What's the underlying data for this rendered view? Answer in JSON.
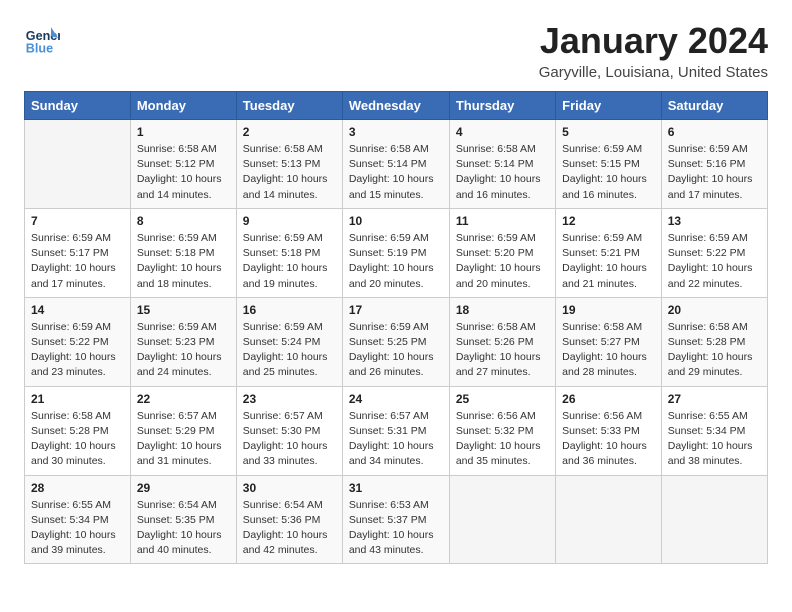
{
  "header": {
    "logo_line1": "General",
    "logo_line2": "Blue",
    "month_year": "January 2024",
    "location": "Garyville, Louisiana, United States"
  },
  "weekdays": [
    "Sunday",
    "Monday",
    "Tuesday",
    "Wednesday",
    "Thursday",
    "Friday",
    "Saturday"
  ],
  "weeks": [
    [
      {
        "day": "",
        "info": ""
      },
      {
        "day": "1",
        "info": "Sunrise: 6:58 AM\nSunset: 5:12 PM\nDaylight: 10 hours\nand 14 minutes."
      },
      {
        "day": "2",
        "info": "Sunrise: 6:58 AM\nSunset: 5:13 PM\nDaylight: 10 hours\nand 14 minutes."
      },
      {
        "day": "3",
        "info": "Sunrise: 6:58 AM\nSunset: 5:14 PM\nDaylight: 10 hours\nand 15 minutes."
      },
      {
        "day": "4",
        "info": "Sunrise: 6:58 AM\nSunset: 5:14 PM\nDaylight: 10 hours\nand 16 minutes."
      },
      {
        "day": "5",
        "info": "Sunrise: 6:59 AM\nSunset: 5:15 PM\nDaylight: 10 hours\nand 16 minutes."
      },
      {
        "day": "6",
        "info": "Sunrise: 6:59 AM\nSunset: 5:16 PM\nDaylight: 10 hours\nand 17 minutes."
      }
    ],
    [
      {
        "day": "7",
        "info": "Sunrise: 6:59 AM\nSunset: 5:17 PM\nDaylight: 10 hours\nand 17 minutes."
      },
      {
        "day": "8",
        "info": "Sunrise: 6:59 AM\nSunset: 5:18 PM\nDaylight: 10 hours\nand 18 minutes."
      },
      {
        "day": "9",
        "info": "Sunrise: 6:59 AM\nSunset: 5:18 PM\nDaylight: 10 hours\nand 19 minutes."
      },
      {
        "day": "10",
        "info": "Sunrise: 6:59 AM\nSunset: 5:19 PM\nDaylight: 10 hours\nand 20 minutes."
      },
      {
        "day": "11",
        "info": "Sunrise: 6:59 AM\nSunset: 5:20 PM\nDaylight: 10 hours\nand 20 minutes."
      },
      {
        "day": "12",
        "info": "Sunrise: 6:59 AM\nSunset: 5:21 PM\nDaylight: 10 hours\nand 21 minutes."
      },
      {
        "day": "13",
        "info": "Sunrise: 6:59 AM\nSunset: 5:22 PM\nDaylight: 10 hours\nand 22 minutes."
      }
    ],
    [
      {
        "day": "14",
        "info": "Sunrise: 6:59 AM\nSunset: 5:22 PM\nDaylight: 10 hours\nand 23 minutes."
      },
      {
        "day": "15",
        "info": "Sunrise: 6:59 AM\nSunset: 5:23 PM\nDaylight: 10 hours\nand 24 minutes."
      },
      {
        "day": "16",
        "info": "Sunrise: 6:59 AM\nSunset: 5:24 PM\nDaylight: 10 hours\nand 25 minutes."
      },
      {
        "day": "17",
        "info": "Sunrise: 6:59 AM\nSunset: 5:25 PM\nDaylight: 10 hours\nand 26 minutes."
      },
      {
        "day": "18",
        "info": "Sunrise: 6:58 AM\nSunset: 5:26 PM\nDaylight: 10 hours\nand 27 minutes."
      },
      {
        "day": "19",
        "info": "Sunrise: 6:58 AM\nSunset: 5:27 PM\nDaylight: 10 hours\nand 28 minutes."
      },
      {
        "day": "20",
        "info": "Sunrise: 6:58 AM\nSunset: 5:28 PM\nDaylight: 10 hours\nand 29 minutes."
      }
    ],
    [
      {
        "day": "21",
        "info": "Sunrise: 6:58 AM\nSunset: 5:28 PM\nDaylight: 10 hours\nand 30 minutes."
      },
      {
        "day": "22",
        "info": "Sunrise: 6:57 AM\nSunset: 5:29 PM\nDaylight: 10 hours\nand 31 minutes."
      },
      {
        "day": "23",
        "info": "Sunrise: 6:57 AM\nSunset: 5:30 PM\nDaylight: 10 hours\nand 33 minutes."
      },
      {
        "day": "24",
        "info": "Sunrise: 6:57 AM\nSunset: 5:31 PM\nDaylight: 10 hours\nand 34 minutes."
      },
      {
        "day": "25",
        "info": "Sunrise: 6:56 AM\nSunset: 5:32 PM\nDaylight: 10 hours\nand 35 minutes."
      },
      {
        "day": "26",
        "info": "Sunrise: 6:56 AM\nSunset: 5:33 PM\nDaylight: 10 hours\nand 36 minutes."
      },
      {
        "day": "27",
        "info": "Sunrise: 6:55 AM\nSunset: 5:34 PM\nDaylight: 10 hours\nand 38 minutes."
      }
    ],
    [
      {
        "day": "28",
        "info": "Sunrise: 6:55 AM\nSunset: 5:34 PM\nDaylight: 10 hours\nand 39 minutes."
      },
      {
        "day": "29",
        "info": "Sunrise: 6:54 AM\nSunset: 5:35 PM\nDaylight: 10 hours\nand 40 minutes."
      },
      {
        "day": "30",
        "info": "Sunrise: 6:54 AM\nSunset: 5:36 PM\nDaylight: 10 hours\nand 42 minutes."
      },
      {
        "day": "31",
        "info": "Sunrise: 6:53 AM\nSunset: 5:37 PM\nDaylight: 10 hours\nand 43 minutes."
      },
      {
        "day": "",
        "info": ""
      },
      {
        "day": "",
        "info": ""
      },
      {
        "day": "",
        "info": ""
      }
    ]
  ]
}
